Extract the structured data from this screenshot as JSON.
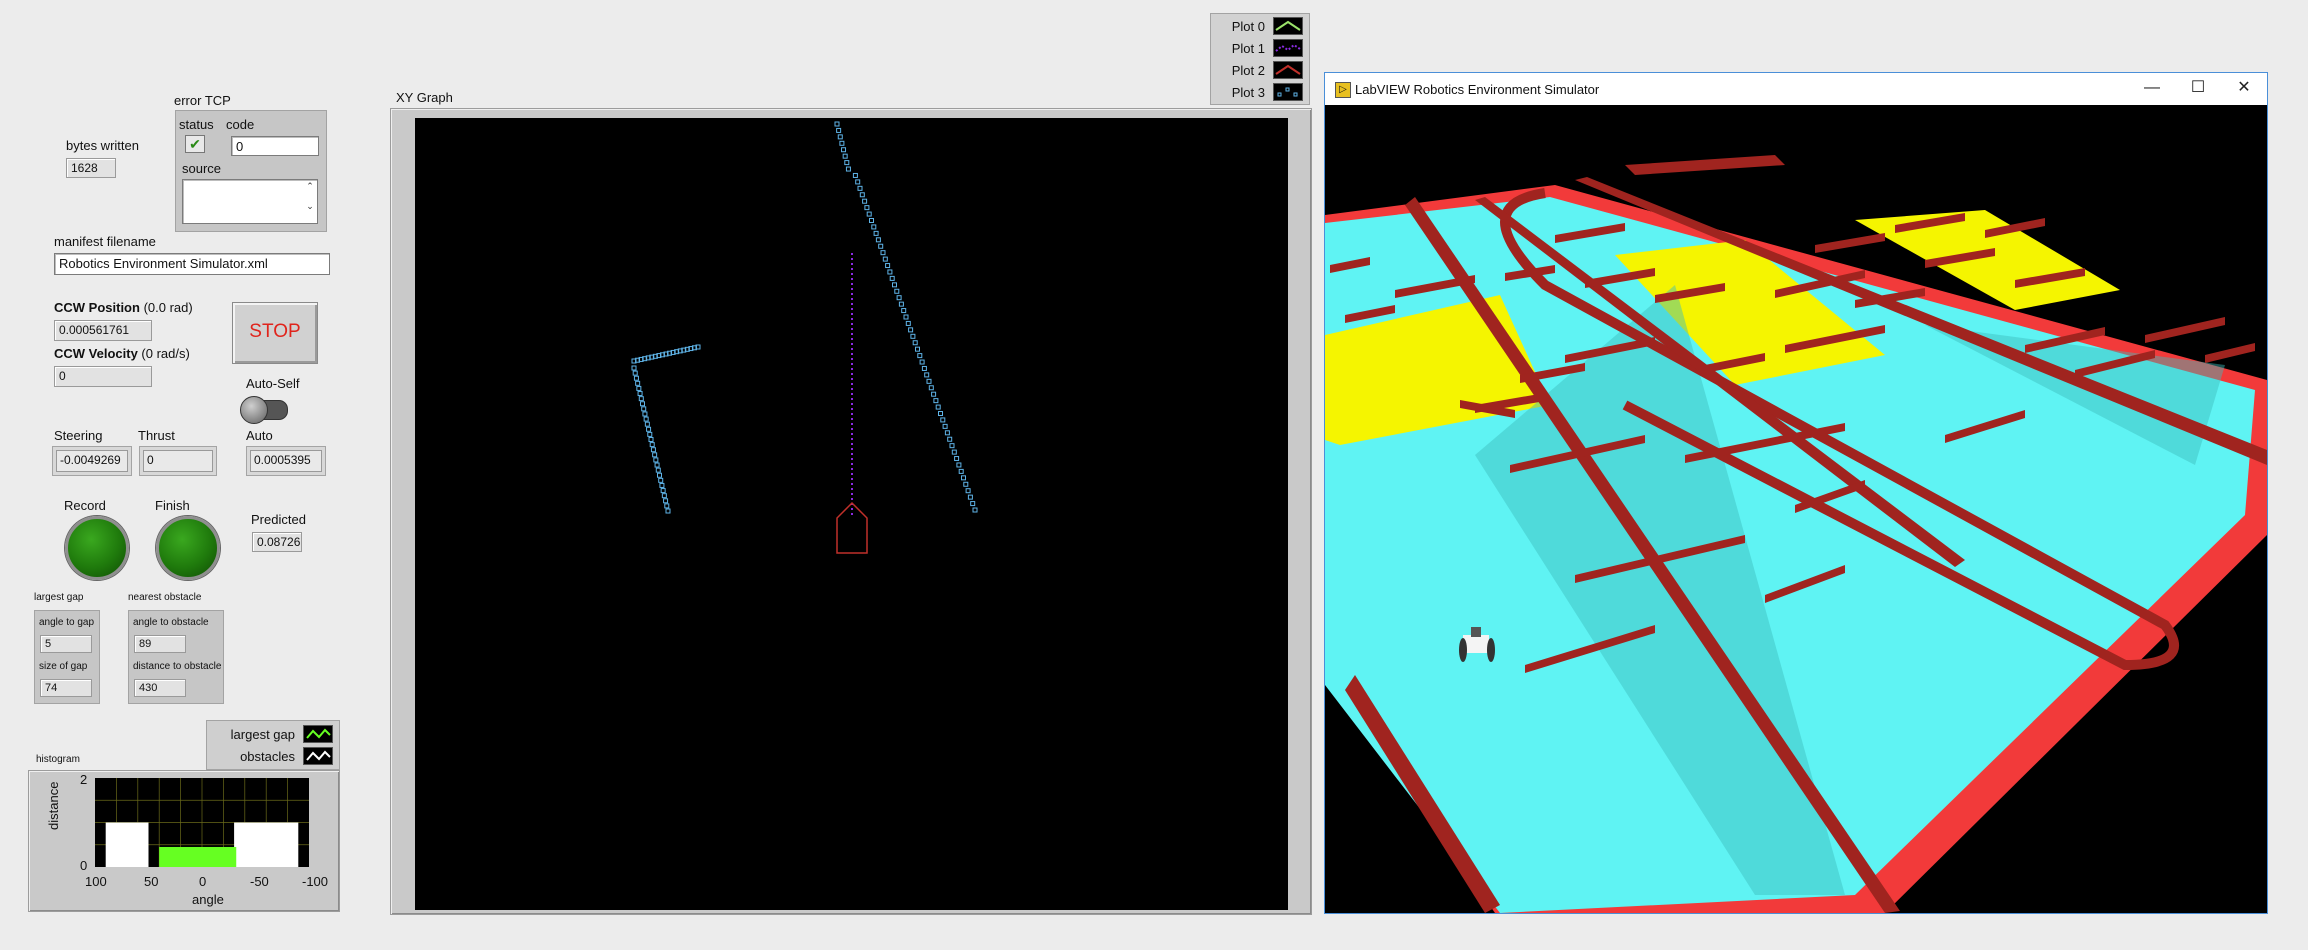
{
  "bytes_written": {
    "label": "bytes written",
    "value": "1628"
  },
  "error_tcp": {
    "title": "error TCP",
    "status_label": "status",
    "code_label": "code",
    "code_value": "0",
    "source_label": "source",
    "source_value": ""
  },
  "manifest": {
    "label": "manifest filename",
    "value": "Robotics Environment Simulator.xml"
  },
  "ccw_position": {
    "label": "CCW Position",
    "unit": "(0.0 rad)",
    "value": "0.000561761"
  },
  "ccw_velocity": {
    "label": "CCW Velocity",
    "unit": "(0 rad/s)",
    "value": "0"
  },
  "stop_button": {
    "label": "STOP"
  },
  "auto_self": {
    "label": "Auto-Self"
  },
  "steering": {
    "label": "Steering",
    "value": "-0.0049269"
  },
  "thrust": {
    "label": "Thrust",
    "value": "0"
  },
  "auto": {
    "label": "Auto",
    "value": "0.0005395"
  },
  "record": {
    "label": "Record"
  },
  "finish": {
    "label": "Finish"
  },
  "predicted": {
    "label": "Predicted",
    "value": "0.08726"
  },
  "largest_gap": {
    "title": "largest gap",
    "angle_label": "angle to gap",
    "angle_value": "5",
    "size_label": "size of gap",
    "size_value": "74"
  },
  "nearest_obstacle": {
    "title": "nearest obstacle",
    "angle_label": "angle to obstacle",
    "angle_value": "89",
    "distance_label": "distance to obstacle",
    "distance_value": "430"
  },
  "histogram": {
    "title": "histogram",
    "legend": [
      "largest gap",
      "obstacles"
    ],
    "ylabel": "distance",
    "xlabel": "angle",
    "yticks": [
      "2",
      "0"
    ],
    "xticks": [
      "100",
      "50",
      "0",
      "-50",
      "-100"
    ]
  },
  "xy_graph": {
    "title": "XY Graph",
    "legend": [
      "Plot 0",
      "Plot 1",
      "Plot 2",
      "Plot 3"
    ]
  },
  "simulator_window": {
    "title": "LabVIEW Robotics Environment Simulator",
    "minimize": "—",
    "maximize": "☐",
    "close": "✕"
  },
  "colors": {
    "graph_bg": "#000000",
    "plot3": "#5fb4e8",
    "plot1": "#8a2be2",
    "plot2": "#c0302a",
    "gap_fill": "#66ff22",
    "floor": "#5ff3f3",
    "wall": "#a0241f",
    "border": "#f23a3a",
    "zone": "#f5f500"
  },
  "chart_data": {
    "type": "bar",
    "categories": [
      "100",
      "50",
      "0",
      "-50",
      "-100"
    ],
    "series": [
      {
        "name": "obstacles",
        "x": [
          90,
          50,
          -30,
          -90
        ],
        "values": [
          1,
          1,
          1,
          1
        ]
      },
      {
        "name": "largest gap",
        "x": [
          40,
          -32
        ],
        "values": [
          0.45,
          0.45
        ]
      }
    ],
    "xlabel": "angle",
    "ylabel": "distance",
    "xlim": [
      100,
      -100
    ],
    "ylim": [
      0,
      2
    ]
  }
}
